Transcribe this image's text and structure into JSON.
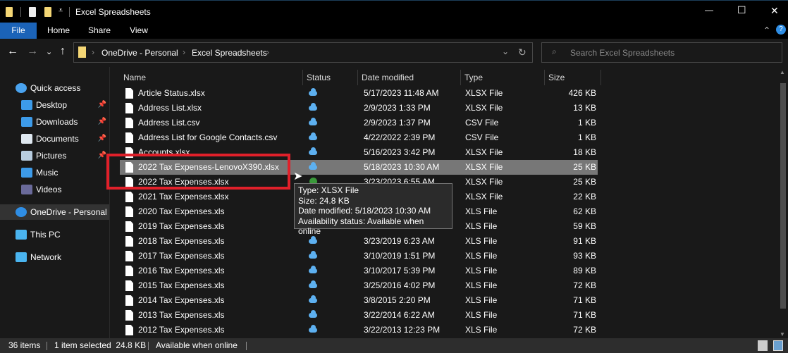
{
  "window": {
    "title": "Excel Spreadsheets",
    "minimize": "—",
    "maximize": "☐",
    "close": "✕"
  },
  "ribbon": {
    "tabs": [
      "File",
      "Home",
      "Share",
      "View"
    ],
    "collapse": "⌃",
    "help": "?"
  },
  "nav": {
    "back": "←",
    "forward": "→",
    "recent": "⌄",
    "up": "↑",
    "refresh": "↻",
    "breadcrumb": [
      "OneDrive - Personal",
      "Excel Spreadsheets"
    ],
    "sep": "›",
    "search_placeholder": "Search Excel Spreadsheets"
  },
  "sidebar": {
    "items": [
      {
        "label": "Quick access",
        "icon": "star-icon",
        "color": "#4aa3ef"
      },
      {
        "label": "Desktop",
        "icon": "desktop-icon",
        "color": "#3d9be9",
        "pinned": true
      },
      {
        "label": "Downloads",
        "icon": "download-icon",
        "color": "#3d9be9",
        "pinned": true
      },
      {
        "label": "Documents",
        "icon": "document-icon",
        "color": "#dfe8f0",
        "pinned": true
      },
      {
        "label": "Pictures",
        "icon": "pictures-icon",
        "color": "#b8cde0",
        "pinned": true
      },
      {
        "label": "Music",
        "icon": "music-icon",
        "color": "#3d9be9"
      },
      {
        "label": "Videos",
        "icon": "videos-icon",
        "color": "#6a6a9a"
      },
      {
        "label": "OneDrive - Personal",
        "icon": "onedrive-icon",
        "color": "#2f8ee5"
      },
      {
        "label": "This PC",
        "icon": "pc-icon",
        "color": "#4ab4ef"
      },
      {
        "label": "Network",
        "icon": "network-icon",
        "color": "#4ab4ef"
      }
    ],
    "pin": "📌"
  },
  "columns": [
    "Name",
    "Status",
    "Date modified",
    "Type",
    "Size"
  ],
  "files": [
    {
      "name": "Article Status.xlsx",
      "status": "cloud",
      "date": "5/17/2023 11:48 AM",
      "type": "XLSX File",
      "size": "426 KB"
    },
    {
      "name": "Address List.xlsx",
      "status": "cloud",
      "date": "2/9/2023 1:33 PM",
      "type": "XLSX File",
      "size": "13 KB"
    },
    {
      "name": "Address List.csv",
      "status": "cloud",
      "date": "2/9/2023 1:37 PM",
      "type": "CSV File",
      "size": "1 KB"
    },
    {
      "name": "Address List for Google Contacts.csv",
      "status": "cloud",
      "date": "4/22/2022 2:39 PM",
      "type": "CSV File",
      "size": "1 KB"
    },
    {
      "name": "Accounts.xlsx",
      "status": "cloud",
      "date": "5/16/2023 3:42 PM",
      "type": "XLSX File",
      "size": "18 KB"
    },
    {
      "name": "2022 Tax Expenses-LenovoX390.xlsx",
      "status": "cloud",
      "date": "5/18/2023 10:30 AM",
      "type": "XLSX File",
      "size": "25 KB",
      "selected": true
    },
    {
      "name": "2022 Tax Expenses.xlsx",
      "status": "check",
      "date": "3/23/2023 6:55 AM",
      "type": "XLSX File",
      "size": "25 KB"
    },
    {
      "name": "2021 Tax Expenses.xlsx",
      "status": "",
      "date": "",
      "type": "XLSX File",
      "size": "22 KB"
    },
    {
      "name": "2020 Tax Expenses.xls",
      "status": "",
      "date": "",
      "type": "XLS File",
      "size": "62 KB"
    },
    {
      "name": "2019 Tax Expenses.xls",
      "status": "",
      "date": "",
      "type": "XLS File",
      "size": "59 KB"
    },
    {
      "name": "2018 Tax Expenses.xls",
      "status": "cloud",
      "date": "3/23/2019 6:23 AM",
      "type": "XLS File",
      "size": "91 KB"
    },
    {
      "name": "2017 Tax Expenses.xls",
      "status": "cloud",
      "date": "3/10/2019 1:51 PM",
      "type": "XLS File",
      "size": "93 KB"
    },
    {
      "name": "2016 Tax Expenses.xls",
      "status": "cloud",
      "date": "3/10/2017 5:39 PM",
      "type": "XLS File",
      "size": "89 KB"
    },
    {
      "name": "2015 Tax Expenses.xls",
      "status": "cloud",
      "date": "3/25/2016 4:02 PM",
      "type": "XLS File",
      "size": "72 KB"
    },
    {
      "name": "2014 Tax Expenses.xls",
      "status": "cloud",
      "date": "3/8/2015 2:20 PM",
      "type": "XLS File",
      "size": "71 KB"
    },
    {
      "name": "2013 Tax Expenses.xls",
      "status": "cloud",
      "date": "3/22/2014 6:22 AM",
      "type": "XLS File",
      "size": "71 KB"
    },
    {
      "name": "2012 Tax Expenses.xls",
      "status": "cloud",
      "date": "3/22/2013 12:23 PM",
      "type": "XLS File",
      "size": "72 KB"
    }
  ],
  "tooltip": {
    "lines": [
      "Type: XLSX File",
      "Size: 24.8 KB",
      "Date modified: 5/18/2023 10:30 AM",
      "Availability status: Available when online"
    ]
  },
  "statusbar": {
    "count": "36 items",
    "selected": "1 item selected  24.8 KB",
    "availability": "Available when online"
  },
  "colors": {
    "file_tab": "#1b63b8",
    "highlight_box": "#e0202a",
    "selected_row": "#777777"
  }
}
